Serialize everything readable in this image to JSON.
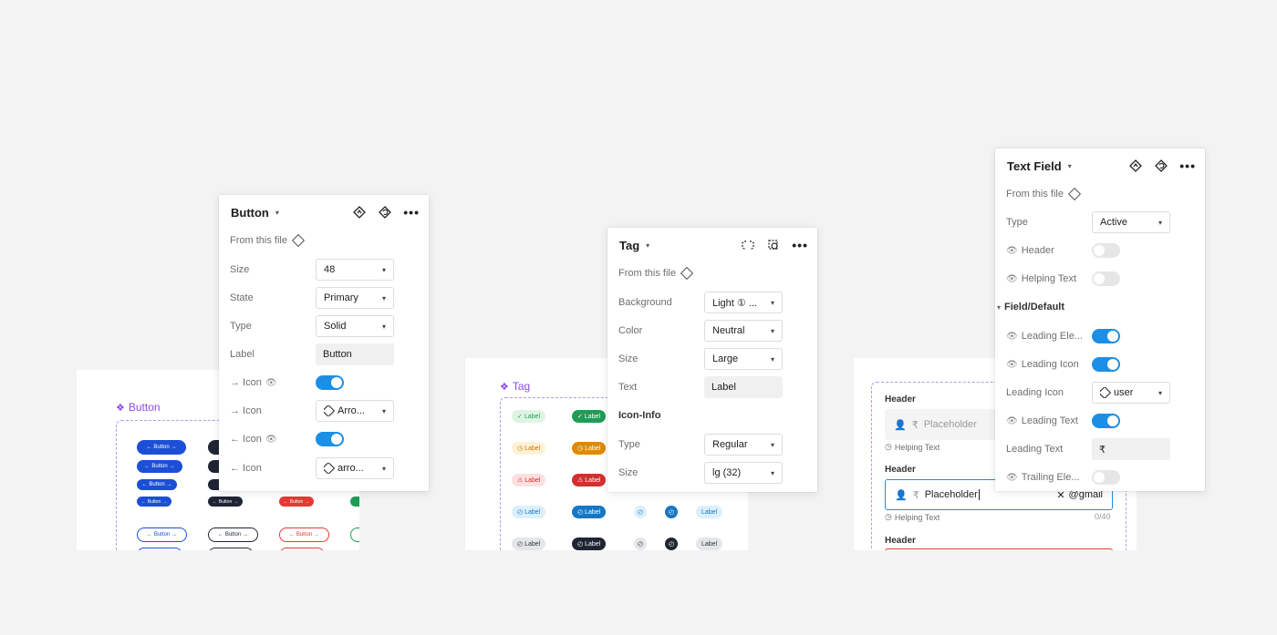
{
  "button_canvas": {
    "title": "Button",
    "filled_btn_label": "Button",
    "red_btn_label": "Button",
    "outline_btn_label": "Button"
  },
  "tag_canvas": {
    "title": "Tag",
    "tag_label": "Label"
  },
  "textfield_canvas": {
    "header1": "Header",
    "placeholder1": "Placeholder",
    "rupee": "₹",
    "helping1": "Helping Text",
    "header2": "Header",
    "placeholder2": "Placeholder",
    "suffix2": "@gmail",
    "helping2": "Helping Text",
    "counter2": "0/40",
    "header3": "Header"
  },
  "button_panel": {
    "title": "Button",
    "from_file": "From this file",
    "rows": [
      {
        "label": "Size",
        "value": "48"
      },
      {
        "label": "State",
        "value": "Primary"
      },
      {
        "label": "Type",
        "value": "Solid"
      },
      {
        "label": "Label",
        "value": "Button"
      },
      {
        "label": "→ Icon",
        "value": ""
      },
      {
        "label": "→ Icon",
        "value": "Arro..."
      },
      {
        "label": "← Icon",
        "value": ""
      },
      {
        "label": "← Icon",
        "value": "arro..."
      }
    ]
  },
  "tag_panel": {
    "title": "Tag",
    "from_file": "From this file",
    "rows": [
      {
        "label": "Background",
        "value": "Light ① ..."
      },
      {
        "label": "Color",
        "value": "Neutral"
      },
      {
        "label": "Size",
        "value": "Large"
      },
      {
        "label": "Text",
        "value": "Label"
      }
    ],
    "section": "Icon-Info",
    "section_rows": [
      {
        "label": "Type",
        "value": "Regular"
      },
      {
        "label": "Size",
        "value": "lg (32)"
      }
    ]
  },
  "textfield_panel": {
    "title": "Text Field",
    "from_file": "From this file",
    "type_label": "Type",
    "type_value": "Active",
    "header_label": "Header",
    "helping_label": "Helping Text",
    "section": "Field/Default",
    "leading_ele_label": "Leading Ele...",
    "leading_icon_toggle_label": "Leading Icon",
    "leading_icon_label": "Leading Icon",
    "leading_icon_value": "user",
    "leading_text_toggle_label": "Leading Text",
    "leading_text_label": "Leading Text",
    "leading_text_value": "₹",
    "trailing_ele_label": "Trailing Ele..."
  },
  "colors": {
    "accent": "#1b8fe5",
    "component_purple": "#8c4de6",
    "btn_blue": "#1c4fd6",
    "btn_dark": "#1f2533",
    "btn_red": "#e53935",
    "btn_green": "#1f9d55"
  }
}
